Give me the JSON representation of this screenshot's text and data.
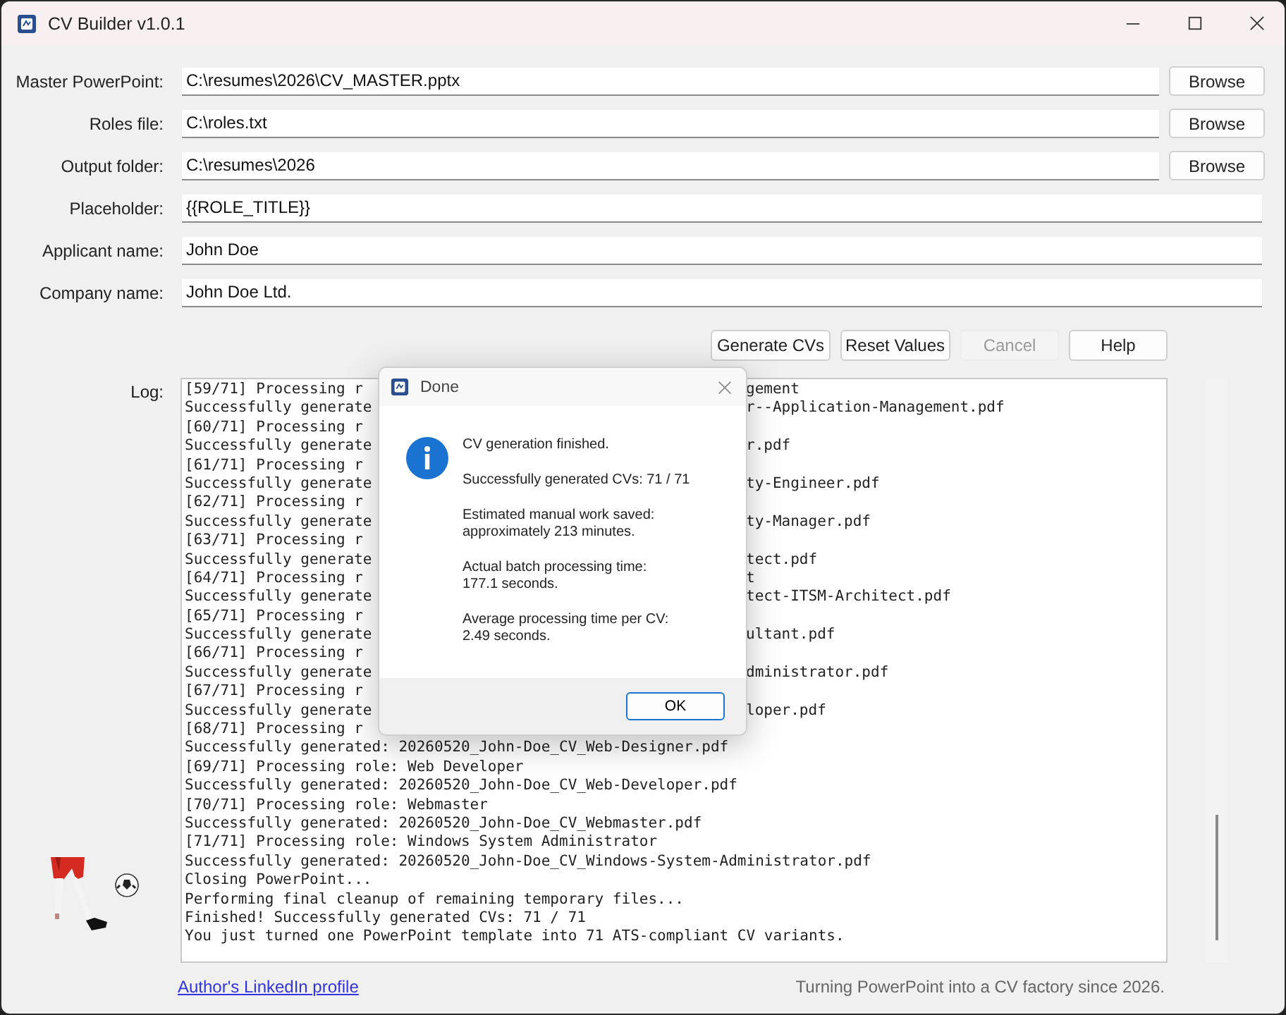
{
  "window": {
    "title": "CV Builder v1.0.1"
  },
  "fields": [
    {
      "label": "Master PowerPoint:",
      "value": "C:\\resumes\\2026\\CV_MASTER.pptx",
      "browse_button": "Browse"
    },
    {
      "label": "Roles file:",
      "value": "C:\\roles.txt",
      "browse_button": "Browse"
    },
    {
      "label": "Output folder:",
      "value": "C:\\resumes\\2026",
      "browse_button": "Browse"
    },
    {
      "label": "Placeholder:",
      "value": "{{ROLE_TITLE}}"
    },
    {
      "label": "Applicant name:",
      "value": "John Doe"
    },
    {
      "label": "Company name:",
      "value": "John Doe Ltd."
    }
  ],
  "buttons": [
    {
      "label": "Generate CVs",
      "disabled": false
    },
    {
      "label": "Reset Values",
      "disabled": false
    },
    {
      "label": "Cancel",
      "disabled": true
    },
    {
      "label": "Help",
      "disabled": false
    }
  ],
  "log": {
    "label": "Log:",
    "lines": [
      {
        "left": "[59/71] Processing r",
        "right": "gement"
      },
      {
        "left": "Successfully generate",
        "right": "r--Application-Management.pdf"
      },
      {
        "left": "[60/71] Processing r"
      },
      {
        "left": "Successfully generate",
        "right": "r.pdf"
      },
      {
        "left": "[61/71] Processing r"
      },
      {
        "left": "Successfully generate",
        "right": "ty-Engineer.pdf"
      },
      {
        "left": "[62/71] Processing r"
      },
      {
        "left": "Successfully generate",
        "right": "ty-Manager.pdf"
      },
      {
        "left": "[63/71] Processing r"
      },
      {
        "left": "Successfully generate",
        "right": "tect.pdf"
      },
      {
        "left": "[64/71] Processing r",
        "right": "t"
      },
      {
        "left": "Successfully generate",
        "right": "tect-ITSM-Architect.pdf"
      },
      {
        "left": "[65/71] Processing r"
      },
      {
        "left": "Successfully generate",
        "right": "ultant.pdf"
      },
      {
        "left": "[66/71] Processing r"
      },
      {
        "left": "Successfully generate",
        "right": "dministrator.pdf"
      },
      {
        "left": "[67/71] Processing r"
      },
      {
        "left": "Successfully generate",
        "right": "loper.pdf"
      },
      {
        "left": "[68/71] Processing r"
      },
      {
        "text": "Successfully generated: 20260520_John-Doe_CV_Web-Designer.pdf"
      },
      {
        "text": "[69/71] Processing role: Web Developer"
      },
      {
        "text": "Successfully generated: 20260520_John-Doe_CV_Web-Developer.pdf"
      },
      {
        "text": "[70/71] Processing role: Webmaster"
      },
      {
        "text": "Successfully generated: 20260520_John-Doe_CV_Webmaster.pdf"
      },
      {
        "text": "[71/71] Processing role: Windows System Administrator"
      },
      {
        "text": "Successfully generated: 20260520_John-Doe_CV_Windows-System-Administrator.pdf"
      },
      {
        "text": "Closing PowerPoint..."
      },
      {
        "text": "Performing final cleanup of remaining temporary files..."
      },
      {
        "text": "Finished! Successfully generated CVs: 71 / 71"
      },
      {
        "text": "You just turned one PowerPoint template into 71 ATS-compliant CV variants."
      }
    ]
  },
  "dialog": {
    "title": "Done",
    "paragraphs": [
      "CV generation finished.",
      "Successfully generated CVs: 71 / 71",
      "Estimated manual work saved:\napproximately 213 minutes.",
      "Actual batch processing time:\n177.1 seconds.",
      "Average processing time per CV:\n2.49 seconds."
    ],
    "ok_button": "OK"
  },
  "footer": {
    "link": "Author's LinkedIn profile",
    "tagline": "Turning PowerPoint into a CV factory since 2026."
  }
}
